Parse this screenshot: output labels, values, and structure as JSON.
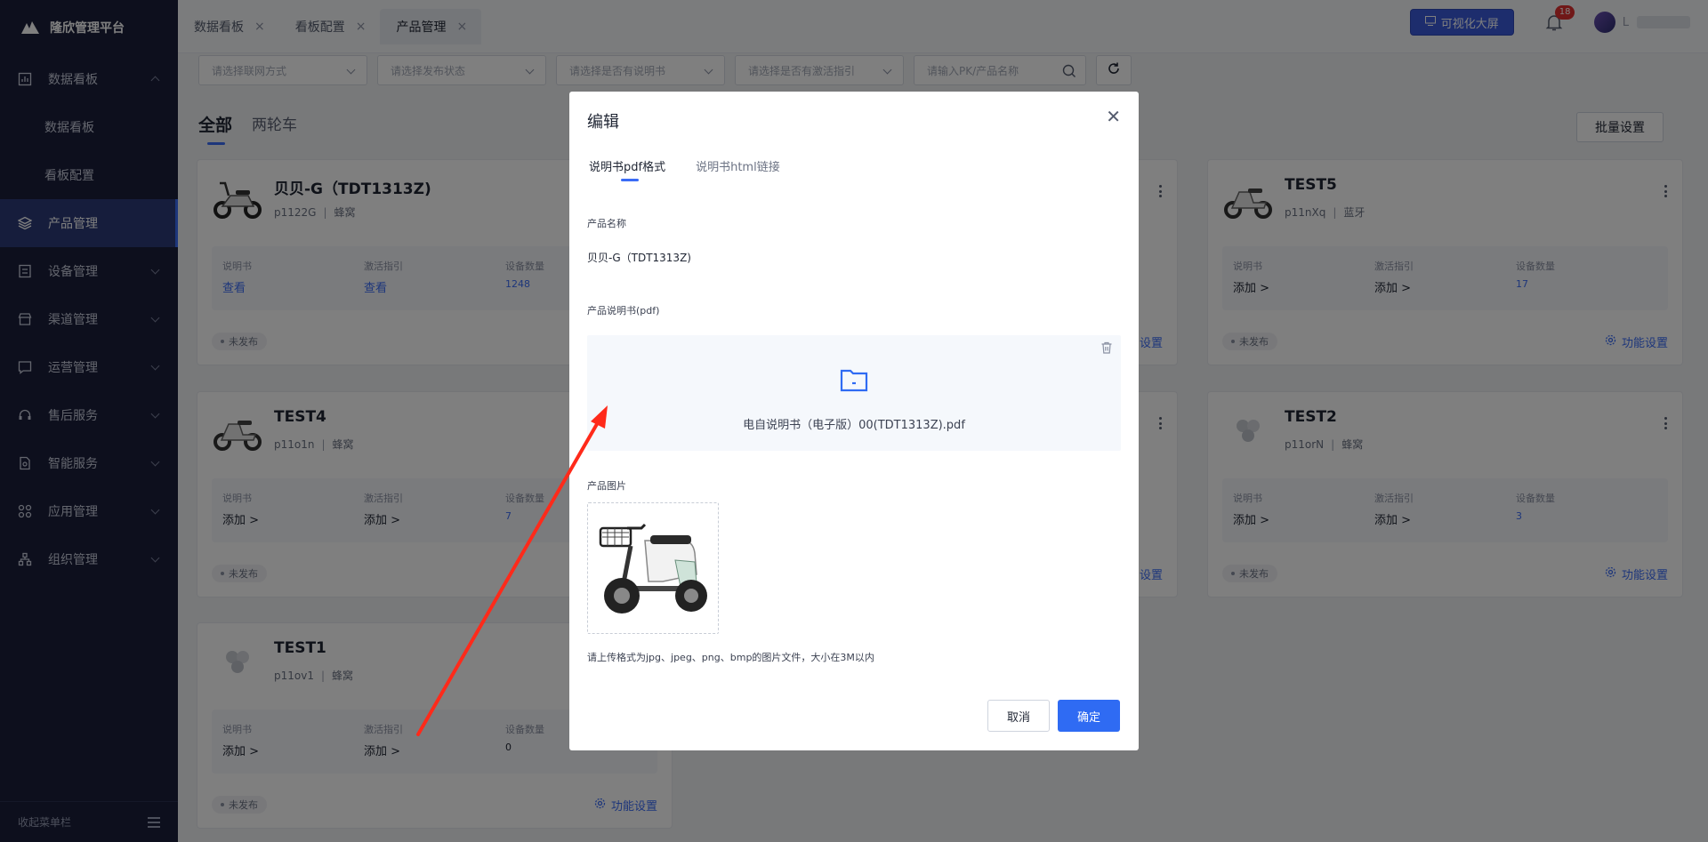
{
  "sidebar": {
    "brand": "隆欣管理平台",
    "items": [
      {
        "label": "数据看板",
        "icon": "chart-icon",
        "expanded": true
      },
      {
        "label": "数据看板",
        "sub": true
      },
      {
        "label": "看板配置",
        "sub": true
      },
      {
        "label": "产品管理",
        "icon": "layers-icon",
        "active": true
      },
      {
        "label": "设备管理",
        "icon": "device-icon"
      },
      {
        "label": "渠道管理",
        "icon": "store-icon"
      },
      {
        "label": "运营管理",
        "icon": "message-icon"
      },
      {
        "label": "售后服务",
        "icon": "headset-icon"
      },
      {
        "label": "智能服务",
        "icon": "document-icon"
      },
      {
        "label": "应用管理",
        "icon": "apps-icon"
      },
      {
        "label": "组织管理",
        "icon": "org-icon"
      }
    ],
    "collapse_label": "收起菜单栏"
  },
  "topbar": {
    "tabs": [
      {
        "label": "数据看板"
      },
      {
        "label": "看板配置"
      },
      {
        "label": "产品管理",
        "active": true
      }
    ],
    "screen_button": "可视化大屏",
    "notification_count": "18",
    "user_name": "L"
  },
  "filters": {
    "network": "请选择联网方式",
    "publish": "请选择发布状态",
    "manual": "请选择是否有说明书",
    "activation": "请选择是否有激活指引",
    "search_placeholder": "请输入PK/产品名称"
  },
  "category_tabs": [
    "全部",
    "两轮车"
  ],
  "batch_button": "批量设置",
  "cards": [
    {
      "title": "贝贝-G（TDT1313Z)",
      "pk": "p1122G",
      "network": "蜂窝",
      "manual_label": "说明书",
      "manual": "查看",
      "activation_label": "激活指引",
      "activation": "查看",
      "devices_label": "设备数量",
      "devices": "1248",
      "status": "未发布",
      "func": "功能设置"
    },
    {
      "title": "TEST5",
      "pk": "p11nXq",
      "network": "蓝牙",
      "manual_label": "说明书",
      "manual": "添加 >",
      "activation_label": "激活指引",
      "activation": "添加 >",
      "devices_label": "设备数量",
      "devices": "17",
      "status": "未发布",
      "func": "功能设置"
    },
    {
      "title": "TEST4",
      "pk": "p11o1n",
      "network": "蜂窝",
      "manual_label": "说明书",
      "manual": "添加 >",
      "activation_label": "激活指引",
      "activation": "添加 >",
      "devices_label": "设备数量",
      "devices": "7",
      "status": "未发布",
      "func": "功能设置"
    },
    {
      "title": "TEST2",
      "pk": "p11orN",
      "network": "蜂窝",
      "manual_label": "说明书",
      "manual": "添加 >",
      "activation_label": "激活指引",
      "activation": "添加 >",
      "devices_label": "设备数量",
      "devices": "3",
      "status": "未发布",
      "func": "功能设置"
    },
    {
      "title": "TEST1",
      "pk": "p11ov1",
      "network": "蜂窝",
      "manual_label": "说明书",
      "manual": "添加 >",
      "activation_label": "激活指引",
      "activation": "添加 >",
      "devices_label": "设备数量",
      "devices": "0",
      "status": "未发布",
      "func": "功能设置"
    }
  ],
  "hidden_card_fragment": "设置",
  "modal": {
    "title": "编辑",
    "tabs": [
      "说明书pdf格式",
      "说明书html链接"
    ],
    "product_name_label": "产品名称",
    "product_name": "贝贝-G（TDT1313Z)",
    "manual_label": "产品说明书(pdf)",
    "pdf_file": "电自说明书（电子版）00(TDT1313Z).pdf",
    "image_label": "产品图片",
    "hint": "请上传格式为jpg、jpeg、png、bmp的图片文件，大小在3M以内",
    "cancel": "取消",
    "ok": "确定"
  }
}
